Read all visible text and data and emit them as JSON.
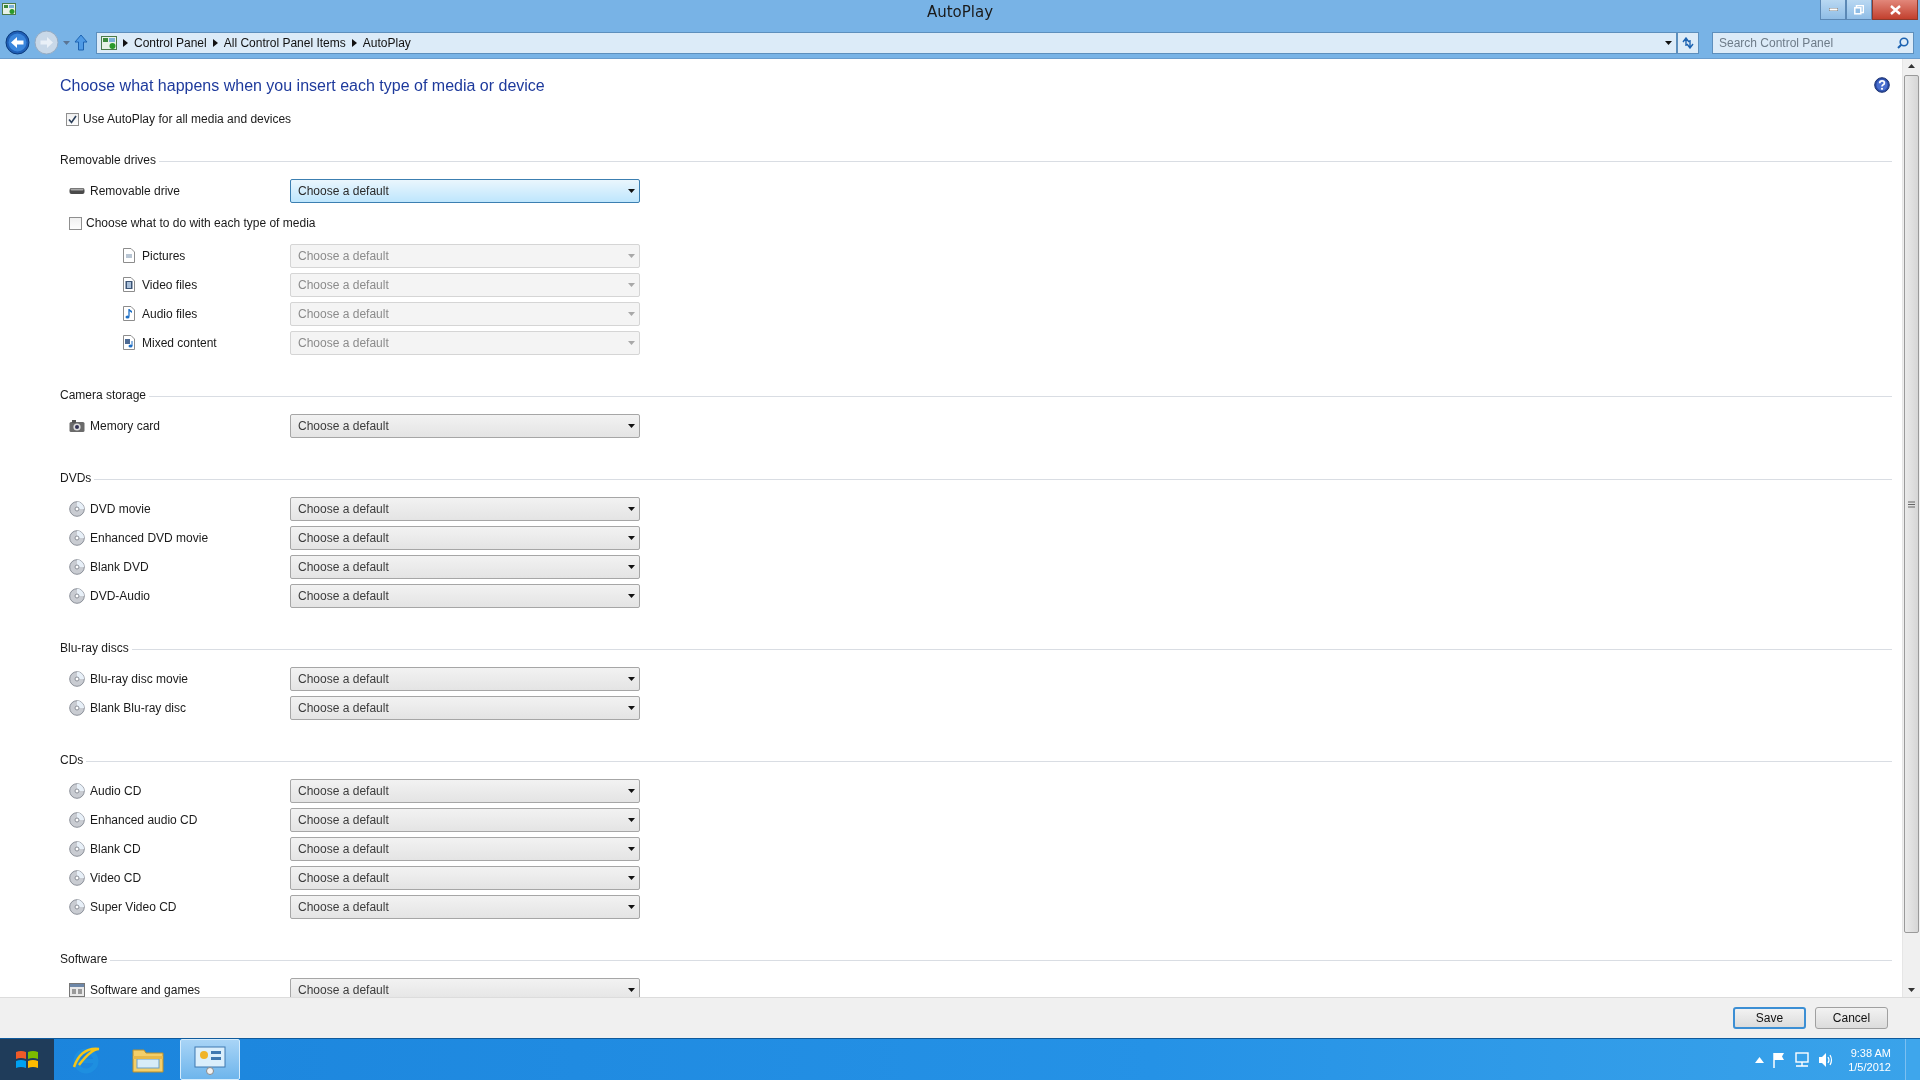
{
  "window": {
    "title": "AutoPlay"
  },
  "navigation": {
    "breadcrumb": [
      "Control Panel",
      "All Control Panel Items",
      "AutoPlay"
    ],
    "search": {
      "placeholder": "Search Control Panel"
    }
  },
  "heading": "Choose what happens when you insert each type of media or device",
  "use_autoplay": {
    "label": "Use AutoPlay for all media and devices",
    "checked": true
  },
  "groups": [
    {
      "title": "Removable drives",
      "items": [
        {
          "kind": "device",
          "label": "Removable drive",
          "dropdown": {
            "value": "Choose a default",
            "disabled": false,
            "focused": true
          }
        },
        {
          "kind": "checkbox",
          "label": "Choose what to do with each type of media",
          "checked": false,
          "children": [
            {
              "kind": "device",
              "label": "Pictures",
              "dropdown": {
                "value": "Choose a default",
                "disabled": true,
                "focused": false
              }
            },
            {
              "kind": "device",
              "label": "Video files",
              "dropdown": {
                "value": "Choose a default",
                "disabled": true,
                "focused": false
              }
            },
            {
              "kind": "device",
              "label": "Audio files",
              "dropdown": {
                "value": "Choose a default",
                "disabled": true,
                "focused": false
              }
            },
            {
              "kind": "device",
              "label": "Mixed content",
              "dropdown": {
                "value": "Choose a default",
                "disabled": true,
                "focused": false
              }
            }
          ]
        }
      ]
    },
    {
      "title": "Camera storage",
      "items": [
        {
          "kind": "device",
          "label": "Memory card",
          "dropdown": {
            "value": "Choose a default",
            "disabled": false,
            "focused": false
          }
        }
      ]
    },
    {
      "title": "DVDs",
      "items": [
        {
          "kind": "device",
          "label": "DVD movie",
          "dropdown": {
            "value": "Choose a default",
            "disabled": false,
            "focused": false
          }
        },
        {
          "kind": "device",
          "label": "Enhanced DVD movie",
          "dropdown": {
            "value": "Choose a default",
            "disabled": false,
            "focused": false
          }
        },
        {
          "kind": "device",
          "label": "Blank DVD",
          "dropdown": {
            "value": "Choose a default",
            "disabled": false,
            "focused": false
          }
        },
        {
          "kind": "device",
          "label": "DVD-Audio",
          "dropdown": {
            "value": "Choose a default",
            "disabled": false,
            "focused": false
          }
        }
      ]
    },
    {
      "title": "Blu-ray discs",
      "items": [
        {
          "kind": "device",
          "label": "Blu-ray disc movie",
          "dropdown": {
            "value": "Choose a default",
            "disabled": false,
            "focused": false
          }
        },
        {
          "kind": "device",
          "label": "Blank Blu-ray disc",
          "dropdown": {
            "value": "Choose a default",
            "disabled": false,
            "focused": false
          }
        }
      ]
    },
    {
      "title": "CDs",
      "items": [
        {
          "kind": "device",
          "label": "Audio CD",
          "dropdown": {
            "value": "Choose a default",
            "disabled": false,
            "focused": false
          }
        },
        {
          "kind": "device",
          "label": "Enhanced audio CD",
          "dropdown": {
            "value": "Choose a default",
            "disabled": false,
            "focused": false
          }
        },
        {
          "kind": "device",
          "label": "Blank CD",
          "dropdown": {
            "value": "Choose a default",
            "disabled": false,
            "focused": false
          }
        },
        {
          "kind": "device",
          "label": "Video CD",
          "dropdown": {
            "value": "Choose a default",
            "disabled": false,
            "focused": false
          }
        },
        {
          "kind": "device",
          "label": "Super Video CD",
          "dropdown": {
            "value": "Choose a default",
            "disabled": false,
            "focused": false
          }
        }
      ]
    },
    {
      "title": "Software",
      "items": [
        {
          "kind": "device",
          "label": "Software and games",
          "dropdown": {
            "value": "Choose a default",
            "disabled": false,
            "focused": false
          }
        }
      ]
    }
  ],
  "footer": {
    "buttons": [
      {
        "label": "Save",
        "default": true
      },
      {
        "label": "Cancel",
        "default": false
      }
    ]
  },
  "taskbar": {
    "apps": [
      {
        "kind": "browser",
        "selected": false
      },
      {
        "kind": "folder",
        "selected": false
      },
      {
        "kind": "control-panel",
        "selected": true
      }
    ],
    "clock": {
      "time": "9:38 AM",
      "date": "1/5/2012"
    }
  }
}
